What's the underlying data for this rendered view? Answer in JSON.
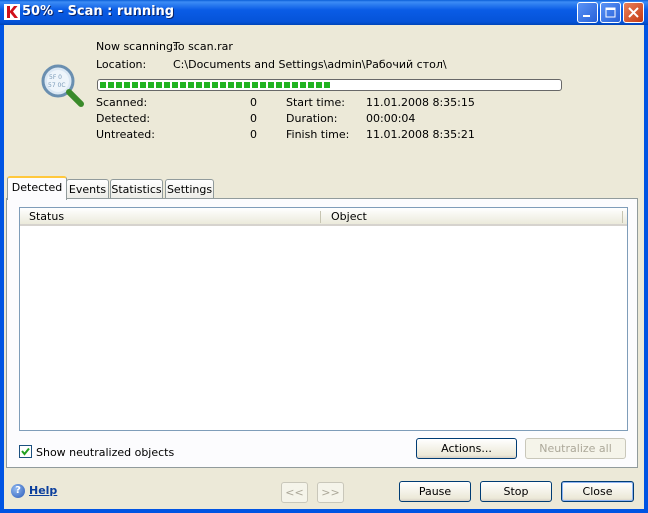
{
  "window": {
    "title": "50% - Scan : running"
  },
  "scan": {
    "now_scanning_label": "Now scanning:",
    "now_scanning_value": "To scan.rar",
    "location_label": "Location:",
    "location_value": "C:\\Documents and Settings\\admin\\Рабочий стол\\",
    "progress": 0.5,
    "progress_color": "#22b322",
    "scanned_label": "Scanned:",
    "scanned_value": "0",
    "detected_label": "Detected:",
    "detected_value": "0",
    "untreated_label": "Untreated:",
    "untreated_value": "0",
    "start_time_label": "Start time:",
    "start_time_value": "11.01.2008 8:35:15",
    "duration_label": "Duration:",
    "duration_value": "00:00:04",
    "finish_time_label": "Finish time:",
    "finish_time_value": "11.01.2008 8:35:21"
  },
  "tabs": [
    {
      "label": "Detected",
      "active": true
    },
    {
      "label": "Events",
      "active": false
    },
    {
      "label": "Statistics",
      "active": false
    },
    {
      "label": "Settings",
      "active": false
    }
  ],
  "detected_list": {
    "columns": [
      "Status",
      "Object"
    ],
    "rows": []
  },
  "show_neutralized": {
    "label": "Show neutralized objects",
    "checked": true
  },
  "buttons": {
    "actions": "Actions...",
    "neutralize_all": "Neutralize all",
    "prev": "<<",
    "next": ">>",
    "pause": "Pause",
    "stop": "Stop",
    "close": "Close"
  },
  "help": {
    "label": "Help"
  },
  "colors": {
    "titlebar": "#0054e3",
    "client_bg": "#ece9d8",
    "accent_tab": "#ffc83c"
  }
}
